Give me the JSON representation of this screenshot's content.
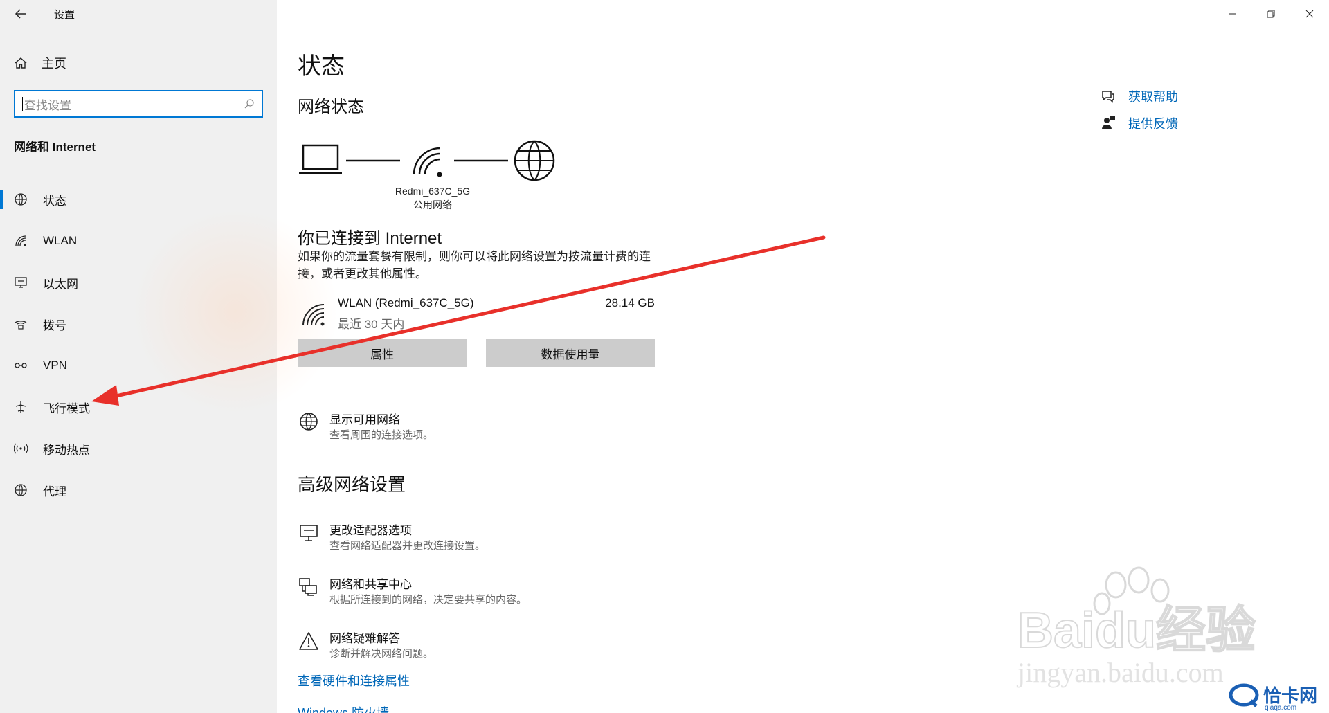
{
  "app": {
    "title": "设置"
  },
  "window_controls": {
    "minimize_icon": "minimize-icon",
    "restore_icon": "restore-icon",
    "close_icon": "close-icon"
  },
  "sidebar": {
    "home_label": "主页",
    "search_placeholder": "查找设置",
    "section_title": "网络和 Internet",
    "items": [
      {
        "label": "状态",
        "icon": "globe-status-icon",
        "active": true
      },
      {
        "label": "WLAN",
        "icon": "wifi-icon",
        "active": false
      },
      {
        "label": "以太网",
        "icon": "ethernet-icon",
        "active": false
      },
      {
        "label": "拨号",
        "icon": "dialup-icon",
        "active": false
      },
      {
        "label": "VPN",
        "icon": "vpn-icon",
        "active": false
      },
      {
        "label": "飞行模式",
        "icon": "airplane-icon",
        "active": false
      },
      {
        "label": "移动热点",
        "icon": "hotspot-icon",
        "active": false
      },
      {
        "label": "代理",
        "icon": "globe-icon",
        "active": false
      }
    ]
  },
  "main": {
    "title": "状态",
    "network_status_title": "网络状态",
    "ssid": "Redmi_637C_5G",
    "network_type": "公用网络",
    "connected_title": "你已连接到 Internet",
    "description": "如果你的流量套餐有限制，则你可以将此网络设置为按流量计费的连接，或者更改其他属性。",
    "connection": {
      "name": "WLAN (Redmi_637C_5G)",
      "period": "最近 30 天内",
      "usage": "28.14 GB"
    },
    "buttons": {
      "properties": "属性",
      "data_usage": "数据使用量"
    },
    "show_networks": {
      "title": "显示可用网络",
      "desc": "查看周围的连接选项。"
    },
    "advanced_title": "高级网络设置",
    "advanced_items": [
      {
        "title": "更改适配器选项",
        "desc": "查看网络适配器并更改连接设置。"
      },
      {
        "title": "网络和共享中心",
        "desc": "根据所连接到的网络，决定要共享的内容。"
      },
      {
        "title": "网络疑难解答",
        "desc": "诊断并解决网络问题。"
      }
    ],
    "hardware_link": "查看硬件和连接属性",
    "firewall_link": "Windows 防火墙"
  },
  "help": {
    "get_help": "获取帮助",
    "feedback": "提供反馈"
  },
  "watermark": {
    "brand": "Baidu经验",
    "url": "jingyan.baidu.com",
    "site": "恰卡网",
    "site_url": "qiaqa.com"
  },
  "colors": {
    "accent": "#0078d4",
    "link": "#0067b8",
    "annotation_arrow": "#e8302a",
    "sidebar_bg": "#f0f0f0",
    "button_bg": "#cccccc"
  }
}
